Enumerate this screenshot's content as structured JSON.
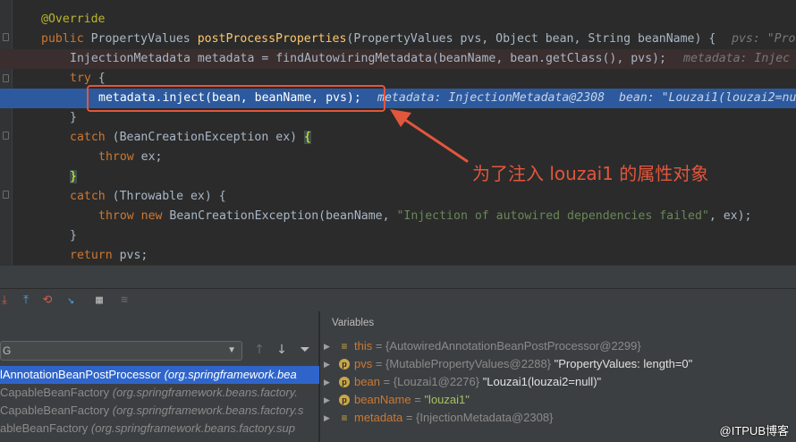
{
  "editor": {
    "lines": [
      {
        "code": "@Override"
      },
      {
        "kw": "public",
        "type": " PropertyValues ",
        "fn": "postProcessProperties",
        "rest": "(PropertyValues pvs, Object bean, String beanName) {",
        "hint": "pvs: \"Pro"
      },
      {
        "code": "InjectionMetadata metadata = findAutowiringMetadata(beanName, bean.getClass(), pvs);",
        "hint": "metadata: Injec"
      },
      {
        "kw": "try",
        "rest": " {"
      },
      {
        "code": "metadata.inject(bean, beanName, pvs);",
        "hint": "metadata: InjectionMetadata@2308  bean: \"Louzai1(louzai2=nu"
      },
      {
        "rest": "}"
      },
      {
        "kw": "catch",
        "rest": " (BeanCreationException ex) ",
        "brace": "{"
      },
      {
        "kw": "throw",
        "rest": " ex;"
      },
      {
        "brace": "}"
      },
      {
        "kw": "catch",
        "rest": " (Throwable ex) {"
      },
      {
        "kw": "throw",
        "kw2": " new",
        "rest": " BeanCreationException(beanName, ",
        "str": "\"Injection of autowired dependencies failed\"",
        "rest2": ", ex);"
      },
      {
        "rest": "}"
      },
      {
        "kw": "return",
        "rest": " pvs;"
      }
    ],
    "annotation_text": "为了注入 louzai1 的属性对象"
  },
  "frames": {
    "thread_label": "G",
    "items": [
      {
        "name": "lAnnotationBeanPostProcessor",
        "pkg": " (org.springframework.bea"
      },
      {
        "name": "CapableBeanFactory",
        "pkg": " (org.springframework.beans.factory."
      },
      {
        "name": "CapableBeanFactory",
        "pkg": " (org.springframework.beans.factory.s"
      },
      {
        "name": "ableBeanFactory",
        "pkg": " (org.springframework.beans.factory.sup"
      }
    ]
  },
  "variables": {
    "title": "Variables",
    "items": [
      {
        "icon": "field",
        "name": "this",
        "ref": " = {AutowiredAnnotationBeanPostProcessor@2299}",
        "val": ""
      },
      {
        "icon": "p",
        "name": "pvs",
        "ref": " = {MutablePropertyValues@2288} ",
        "val": "\"PropertyValues: length=0\""
      },
      {
        "icon": "p",
        "name": "bean",
        "ref": " = {Louzai1@2276} ",
        "val": "\"Louzai1(louzai2=null)\""
      },
      {
        "icon": "p",
        "name": "beanName",
        "ref": " = ",
        "str": "\"louzai1\""
      },
      {
        "icon": "field",
        "name": "metadata",
        "ref": " = {InjectionMetadata@2308}",
        "val": ""
      }
    ]
  },
  "watermark": "@ITPUB博客",
  "colors": {
    "keyword": "#cc7832",
    "function": "#ffc66d",
    "string": "#6a8759",
    "annotation_red": "#e2563c",
    "exec_line": "#2d5a9e"
  }
}
